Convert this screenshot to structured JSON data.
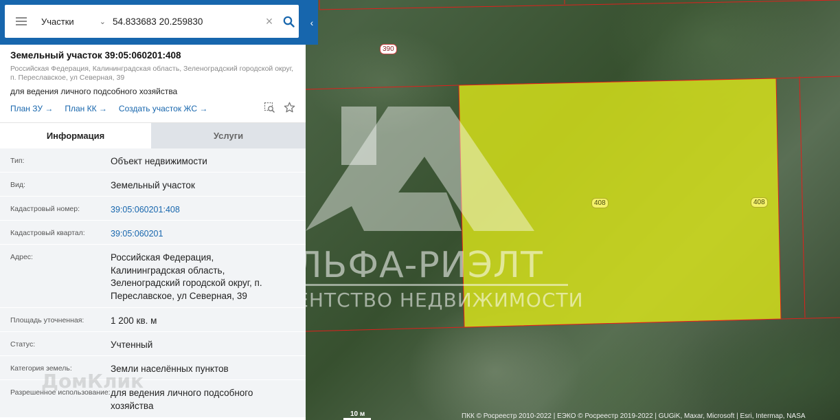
{
  "search": {
    "layer": "Участки",
    "query": "54.833683 20.259830"
  },
  "object": {
    "title": "Земельный участок 39:05:060201:408",
    "address": "Российская Федерация, Калининградская область, Зеленоградский городской округ, п. Переславское, ул Северная, 39",
    "purpose": "для ведения личного подсобного хозяйства",
    "links": [
      "План ЗУ →",
      "План КК →",
      "Создать участок ЖС →"
    ]
  },
  "tabs": {
    "info": "Информация",
    "services": "Услуги"
  },
  "rows": [
    {
      "label": "Тип:",
      "value": "Объект недвижимости"
    },
    {
      "label": "Вид:",
      "value": "Земельный участок"
    },
    {
      "label": "Кадастровый номер:",
      "value": "39:05:060201:408"
    },
    {
      "label": "Кадастровый квартал:",
      "value": "39:05:060201"
    },
    {
      "label": "Адрес:",
      "value": "Российская Федерация, Калининградская область, Зеленоградский городской округ, п. Переславское, ул Северная, 39"
    },
    {
      "label": "Площадь уточненная:",
      "value": "1 200 кв. м"
    },
    {
      "label": "Статус:",
      "value": "Учтенный"
    },
    {
      "label": "Категория земель:",
      "value": "Земли населённых пунктов"
    },
    {
      "label": "Разрешенное использование:",
      "value": "для ведения личного подсобного хозяйства"
    }
  ],
  "map": {
    "parcel_labels": [
      "390",
      "408",
      "408"
    ],
    "scale": "10 м",
    "attribution": "ПКК © Росреестр 2010-2022 | ЕЭКО © Росреестр 2019-2022 | GUGiK, Maxar, Microsoft | Esri, Intermap, NASA",
    "watermark_line1": "АЛЬФА-РИЭЛТ",
    "watermark_line2": "АГЕНТСТВО НЕДВИЖИМОСТИ",
    "domclick": "ДомКлик",
    "parcel_fill": "#e6f01f",
    "boundary_color": "#e0201c"
  },
  "colors": {
    "brand": "#1766ad",
    "link": "#1766ad"
  }
}
